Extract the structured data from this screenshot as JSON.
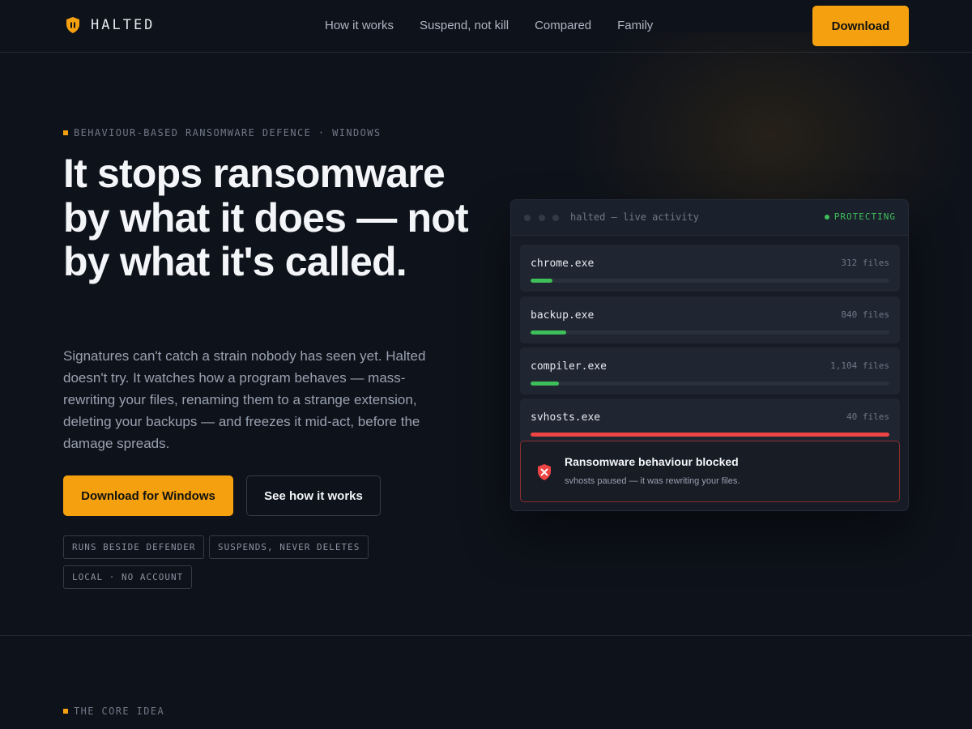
{
  "nav": {
    "brand": "HALTED",
    "links": [
      "How it works",
      "Suspend, not kill",
      "Compared",
      "Family"
    ],
    "download_label": "Download"
  },
  "hero": {
    "eyebrow": "BEHAVIOUR-BASED RANSOMWARE DEFENCE · WINDOWS",
    "headline": "It stops ransomware by what it does — not by what it's called.",
    "lede": "Signatures can't catch a strain nobody has seen yet. Halted doesn't try. It watches how a program behaves — mass-rewriting your files, renaming them to a strange extension, deleting your backups — and freezes it mid-act, before the damage spreads.",
    "primary_cta": "Download for Windows",
    "secondary_cta": "See how it works",
    "chips": [
      "RUNS BESIDE DEFENDER",
      "SUSPENDS, NEVER DELETES",
      "LOCAL · NO ACCOUNT"
    ]
  },
  "panel": {
    "title": "halted — live activity",
    "status": "PROTECTING",
    "processes": [
      {
        "name": "chrome.exe",
        "files": "312 files",
        "level": 0.06,
        "state": "ok"
      },
      {
        "name": "backup.exe",
        "files": "840 files",
        "level": 0.1,
        "state": "ok"
      },
      {
        "name": "compiler.exe",
        "files": "1,104 files",
        "level": 0.08,
        "state": "ok"
      },
      {
        "name": "svhosts.exe",
        "files": "40 files",
        "level": 1.0,
        "state": "blocked"
      }
    ],
    "alert": {
      "title": "Ransomware behaviour blocked",
      "text": "svhosts paused — it was rewriting your files."
    }
  },
  "next_section": {
    "eyebrow": "THE CORE IDEA"
  },
  "colors": {
    "accent": "#f5a10f",
    "ok": "#3fbf5a",
    "danger": "#ef4444",
    "background": "#0e121a"
  },
  "icons": {
    "brand": "shield-pause-icon",
    "alert": "shield-x-icon"
  }
}
